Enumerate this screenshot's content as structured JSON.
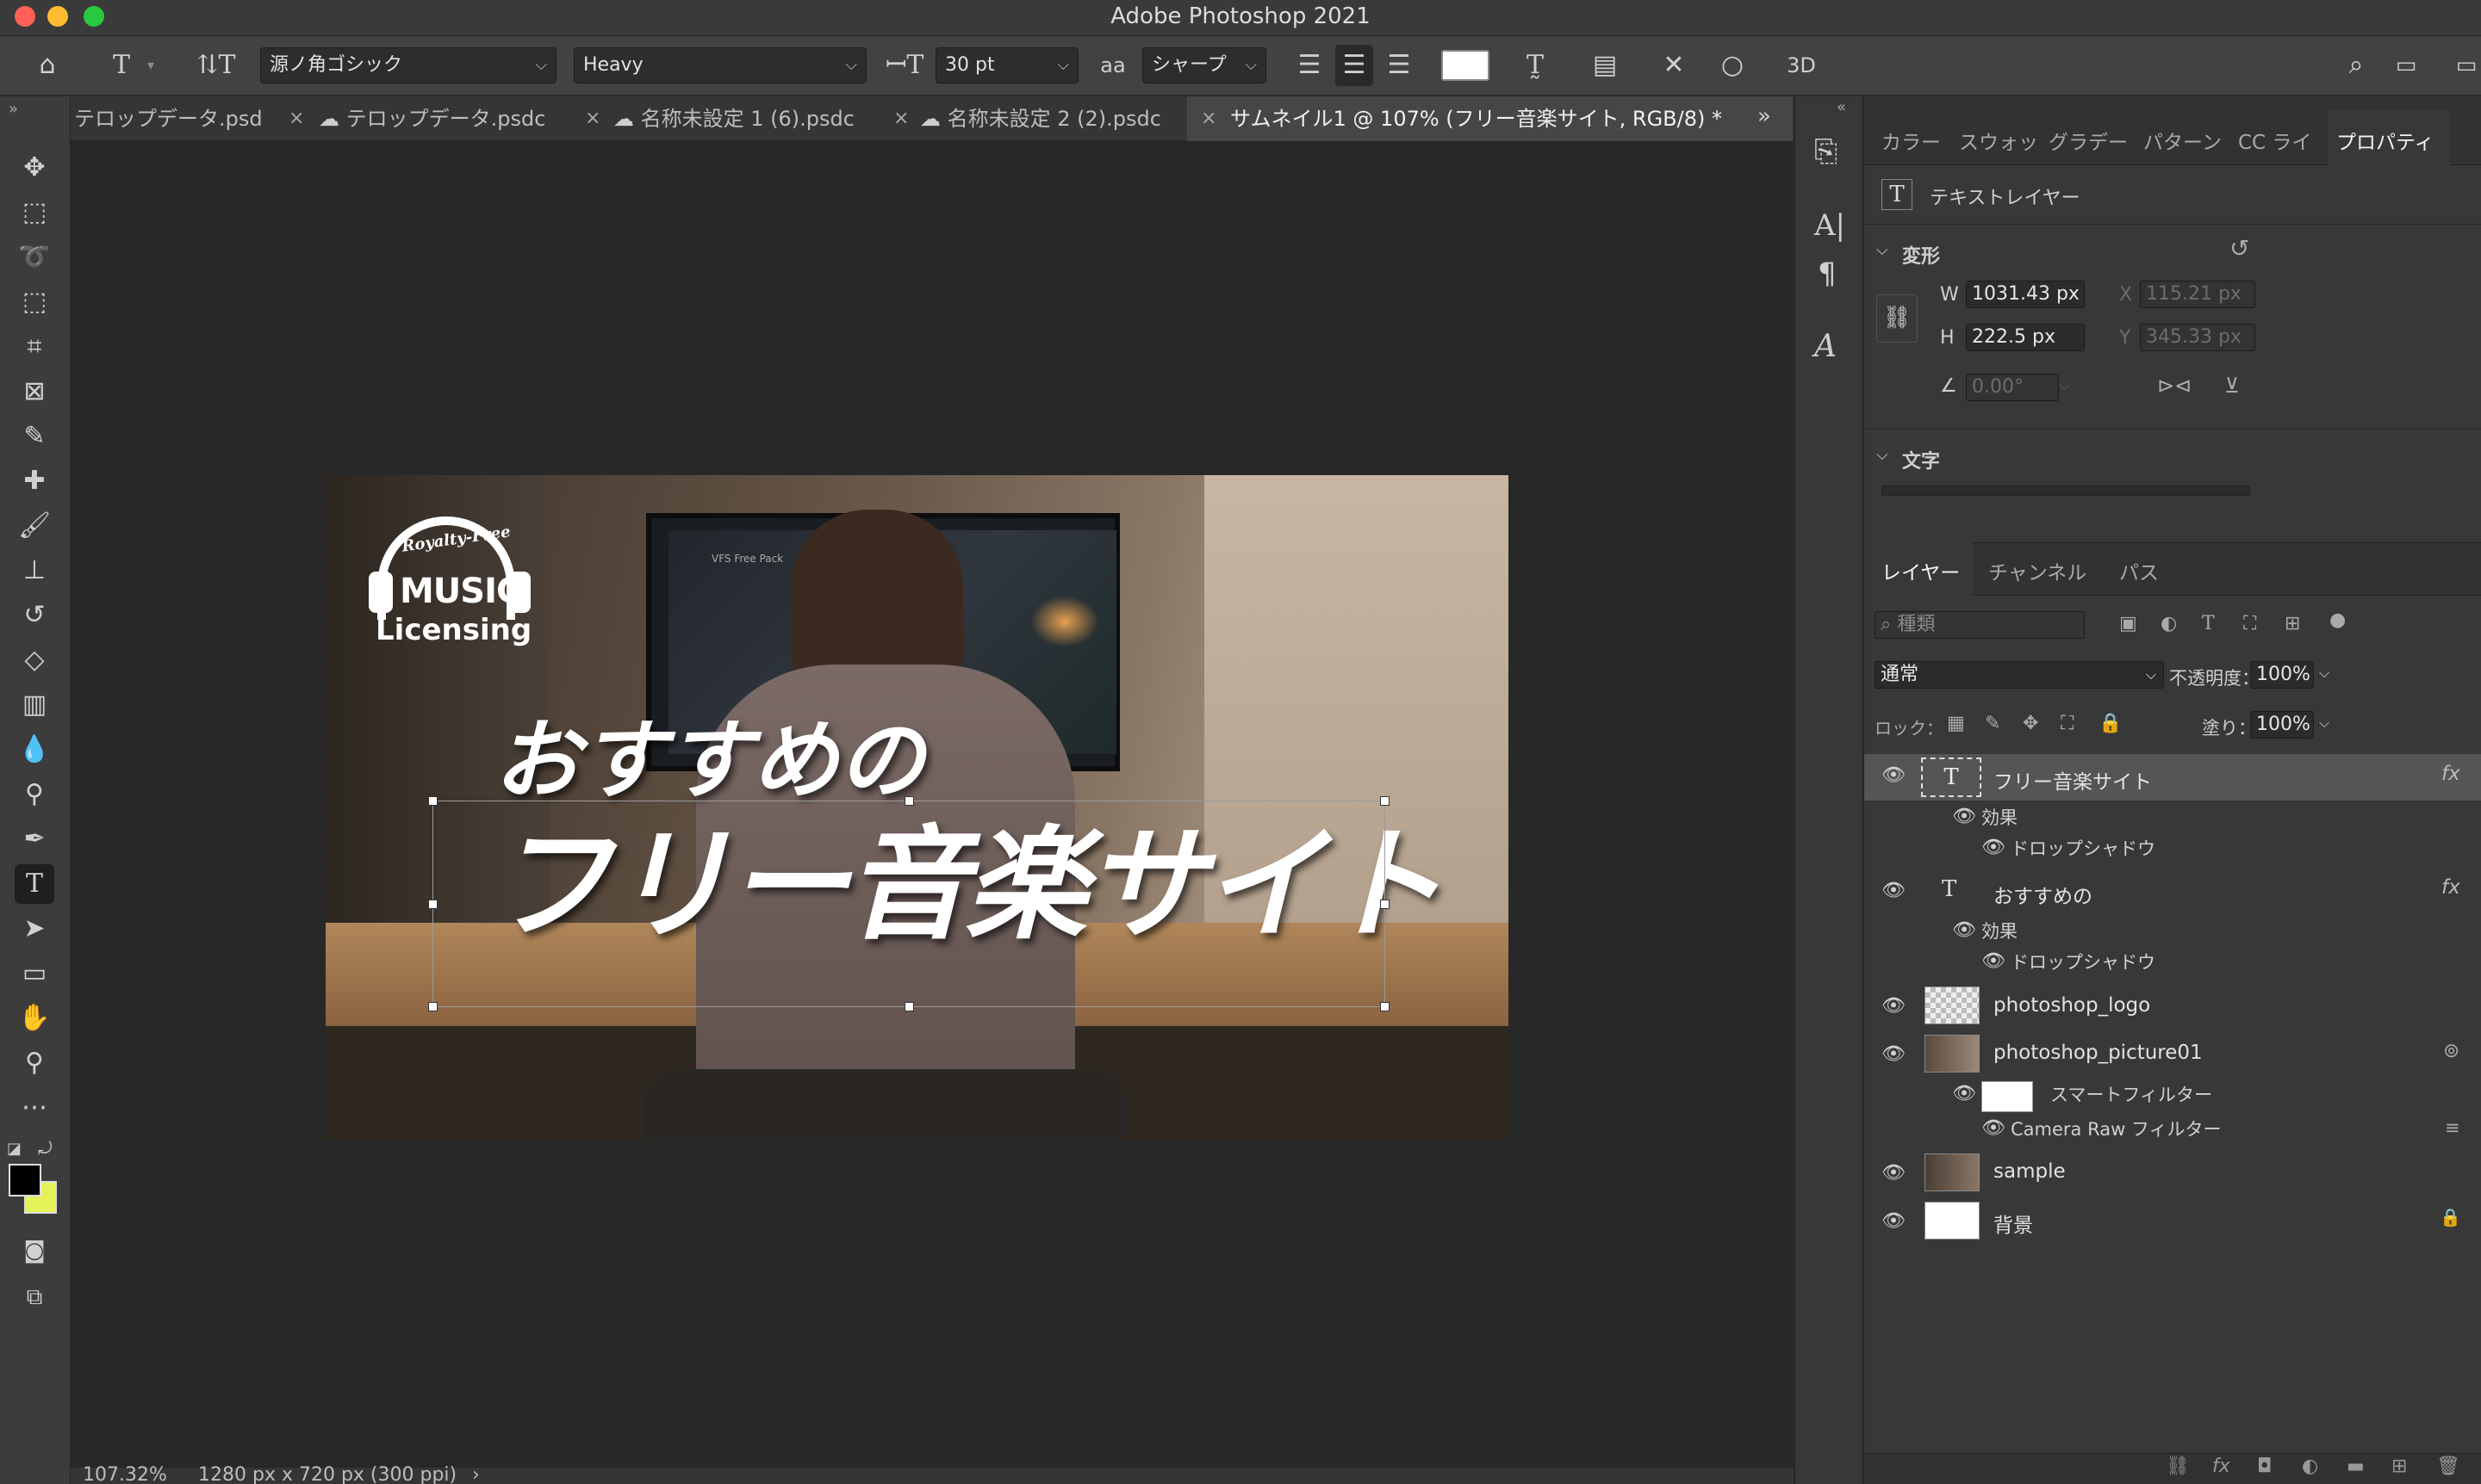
{
  "window": {
    "title": "Adobe Photoshop 2021"
  },
  "options_bar": {
    "font_family": "源ノ角ゴシック",
    "font_style": "Heavy",
    "font_size": "30 pt",
    "antialias_icon_label": "aa",
    "antialias": "シャープ",
    "color_swatch": "#ffffff"
  },
  "tabs": [
    {
      "label": "テロップデータ.psd",
      "cloud": false
    },
    {
      "label": "テロップデータ.psdc",
      "cloud": true
    },
    {
      "label": "名称未設定 1 (6).psdc",
      "cloud": true
    },
    {
      "label": "名称未設定 2 (2).psdc",
      "cloud": true
    },
    {
      "label": "サムネイル1 @ 107% (フリー音楽サイト, RGB/8) *",
      "cloud": false,
      "active": true
    }
  ],
  "canvas": {
    "logo_top": "Royalty-Free",
    "logo_mid": "MUSIC",
    "logo_bottom": "Licensing",
    "headline_small": "おすすめの",
    "headline_large": "フリー音楽サイト",
    "monitor_text": "VFS Free Pack"
  },
  "status": {
    "zoom": "107.32%",
    "doc_info": "1280 px x 720 px (300 ppi)",
    "arrow": "›"
  },
  "properties": {
    "tabs": [
      "カラー",
      "スウォッ",
      "グラデー",
      "パターン",
      "CC ライ",
      "プロパティ"
    ],
    "layer_kind": "テキストレイヤー",
    "transform_title": "変形",
    "w_label": "W",
    "w": "1031.43 px",
    "h_label": "H",
    "h": "222.5 px",
    "x_label": "X",
    "x": "115.21 px",
    "y_label": "Y",
    "y": "345.33 px",
    "angle": "0.00°",
    "char_title": "文字"
  },
  "layers_panel": {
    "tabs": [
      "レイヤー",
      "チャンネル",
      "パス"
    ],
    "filter_placeholder": "種類",
    "blend_mode": "通常",
    "opacity_label": "不透明度：",
    "opacity": "100%",
    "lock_label": "ロック：",
    "fill_label": "塗り：",
    "fill": "100%",
    "layers": [
      {
        "name": "フリー音楽サイト",
        "type": "text",
        "fx": "fx",
        "effects_label": "効果",
        "effect": "ドロップシャドウ",
        "selected": true
      },
      {
        "name": "おすすめの",
        "type": "text",
        "fx": "fx",
        "effects_label": "効果",
        "effect": "ドロップシャドウ"
      },
      {
        "name": "photoshop_logo",
        "type": "image"
      },
      {
        "name": "photoshop_picture01",
        "type": "smart",
        "smart_filters": "スマートフィルター",
        "filter": "Camera Raw フィルター"
      },
      {
        "name": "sample",
        "type": "image"
      },
      {
        "name": "背景",
        "type": "background"
      }
    ]
  },
  "colors": {
    "accent": "#2d77d6",
    "panel": "#383838",
    "canvas_bg": "#282828",
    "background_color": "#e6f25a"
  }
}
